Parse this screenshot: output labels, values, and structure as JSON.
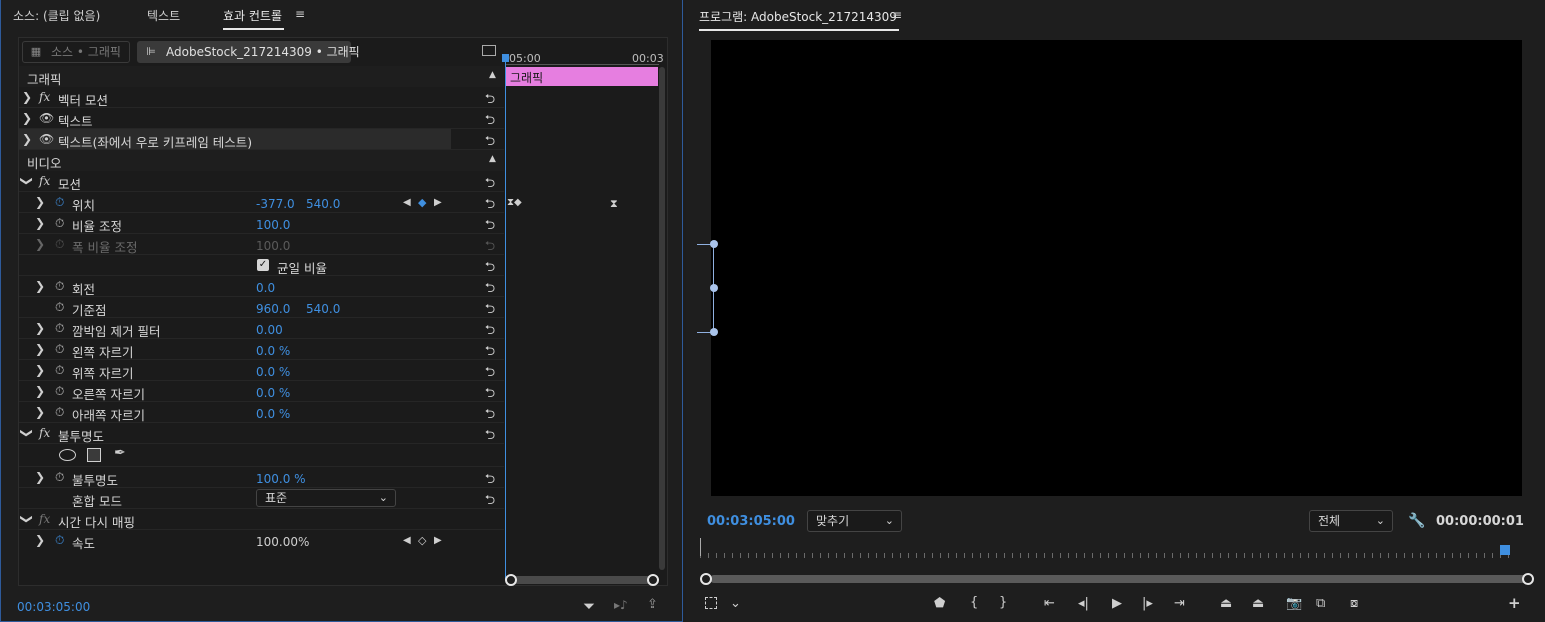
{
  "left_panel": {
    "tabs": [
      {
        "label": "소스: (클립 없음)"
      },
      {
        "label": "텍스트"
      },
      {
        "label": "효과 컨트롤"
      }
    ],
    "source_chip": "소스 • 그래픽",
    "clip_chip": "AdobeStock_217214309 • 그래픽",
    "ruler": {
      "t1": "05:00",
      "t2": "00:03"
    },
    "clip_bar_label": "그래픽",
    "sections": {
      "graphic": "그래픽",
      "video": "비디오"
    },
    "rows": {
      "vector_motion": "벡터 모션",
      "text1": "텍스트",
      "text2": "텍스트(좌에서 우로 키프레임 테스트)",
      "motion": "모션",
      "position": {
        "label": "위치",
        "x": "-377.0",
        "y": "540.0"
      },
      "scale": {
        "label": "비율 조정",
        "value": "100.0"
      },
      "scale_width": {
        "label": "폭 비율 조정",
        "value": "100.0"
      },
      "uniform": {
        "label": "균일 비율"
      },
      "rotation": {
        "label": "회전",
        "value": "0.0"
      },
      "anchor": {
        "label": "기준점",
        "x": "960.0",
        "y": "540.0"
      },
      "flicker": {
        "label": "깜박임 제거 필터",
        "value": "0.00"
      },
      "crop_left": {
        "label": "왼쪽 자르기",
        "value": "0.0 %"
      },
      "crop_top": {
        "label": "위쪽 자르기",
        "value": "0.0 %"
      },
      "crop_right": {
        "label": "오른쪽 자르기",
        "value": "0.0 %"
      },
      "crop_bottom": {
        "label": "아래쪽 자르기",
        "value": "0.0 %"
      },
      "opacity_group": "불투명도",
      "opacity": {
        "label": "불투명도",
        "value": "100.0 %"
      },
      "blend": {
        "label": "혼합 모드",
        "value": "표준"
      },
      "time_remap": "시간 다시 매핑",
      "speed": {
        "label": "속도",
        "value": "100.00%"
      }
    },
    "timecode": "00:03:05:00"
  },
  "right_panel": {
    "title": "프로그램: AdobeStock_217214309",
    "timecode": "00:03:05:00",
    "zoom": "맞추기",
    "quality": "전체",
    "duration": "00:00:00:01"
  },
  "colors": {
    "accent": "#3f8fe0",
    "clip": "#e67ee0",
    "background": "#1e1e1e"
  }
}
